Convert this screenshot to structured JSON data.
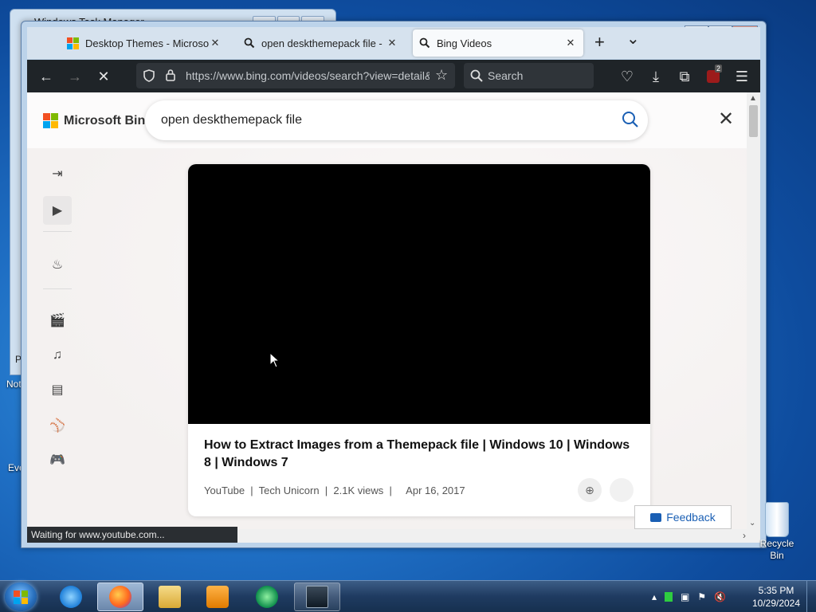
{
  "desktop": {
    "background_window_title": "Windows Task Manager",
    "icon_labels": [
      "Not",
      "Eve",
      "P"
    ],
    "recycle_bin": "Recycle Bin"
  },
  "browser": {
    "tabs": [
      {
        "title": "Desktop Themes - Microsoft Store",
        "close": "✕"
      },
      {
        "title": "open deskthemepack file - Search",
        "close": "✕"
      },
      {
        "title": "Bing Videos",
        "close": "✕"
      }
    ],
    "new_tab": "+",
    "tab_list": "⌄",
    "url": "https://www.bing.com/videos/search?view=detail&",
    "search_placeholder": "Search",
    "extension_badge": "2",
    "status_text": "Waiting for www.youtube.com..."
  },
  "bing": {
    "logo_text": "Microsoft Bing",
    "query": "open deskthemepack file",
    "close": "✕",
    "video": {
      "title": "How to Extract Images from a Themepack file | Windows 10 | Windows 8 | Windows 7",
      "meta": "YouTube  |  Tech Unicorn  |  2.1K views  |     Apr 16, 2017"
    },
    "feedback": "Feedback"
  },
  "taskbar": {
    "time": "5:35 PM",
    "date": "10/29/2024"
  },
  "colors": {
    "accent": "#1a5fb4",
    "toolbar": "#1f2428",
    "tab_strip": "#d6e2ee"
  }
}
